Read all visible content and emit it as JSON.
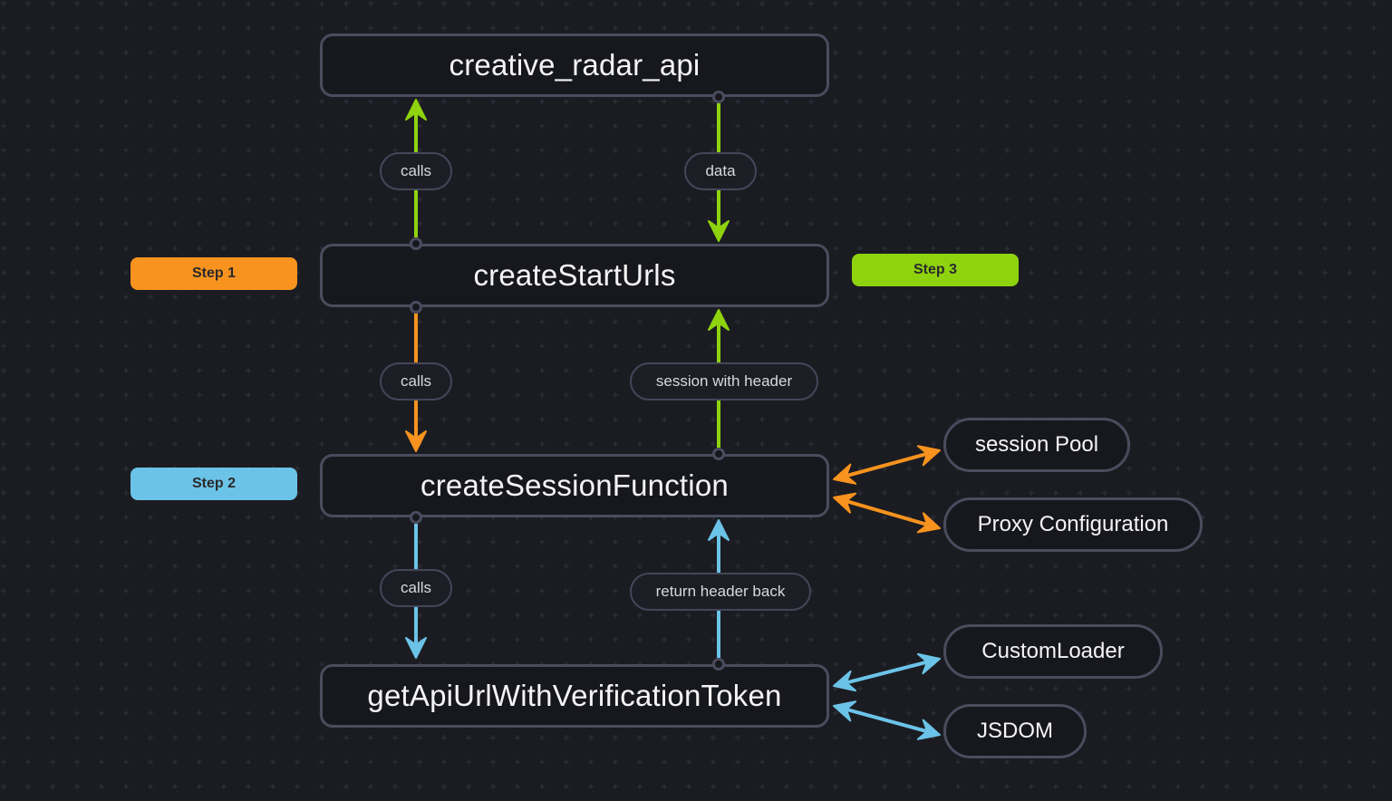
{
  "colors": {
    "green": "#8fd30f",
    "orange": "#f7931e",
    "blue": "#6cc3e8",
    "node_border": "#4a4c5e"
  },
  "nodes": {
    "creative_radar_api": "creative_radar_api",
    "createStartUrls": "createStartUrls",
    "createSessionFunction": "createSessionFunction",
    "getApiUrlWithVerificationToken": "getApiUrlWithVerificationToken"
  },
  "side_nodes": {
    "session_pool": "session Pool",
    "proxy_configuration": "Proxy Configuration",
    "custom_loader": "CustomLoader",
    "jsdom": "JSDOM"
  },
  "steps": {
    "step1": {
      "label": "Step 1",
      "color": "#f7931e"
    },
    "step2": {
      "label": "Step 2",
      "color": "#6cc3e8"
    },
    "step3": {
      "label": "Step 3",
      "color": "#8fd30f"
    }
  },
  "edges": [
    {
      "from": "createStartUrls",
      "to": "creative_radar_api",
      "label": "calls",
      "color": "green"
    },
    {
      "from": "creative_radar_api",
      "to": "createStartUrls",
      "label": "data",
      "color": "green"
    },
    {
      "from": "createStartUrls",
      "to": "createSessionFunction",
      "label": "calls",
      "color": "orange"
    },
    {
      "from": "createSessionFunction",
      "to": "createStartUrls",
      "label": "session with header",
      "color": "green"
    },
    {
      "from": "createSessionFunction",
      "to": "getApiUrlWithVerificationToken",
      "label": "calls",
      "color": "blue"
    },
    {
      "from": "getApiUrlWithVerificationToken",
      "to": "createSessionFunction",
      "label": "return header back",
      "color": "blue"
    },
    {
      "from": "createSessionFunction",
      "to": "session Pool",
      "label": "",
      "color": "orange",
      "bidirectional": true
    },
    {
      "from": "createSessionFunction",
      "to": "Proxy Configuration",
      "label": "",
      "color": "orange",
      "bidirectional": true
    },
    {
      "from": "getApiUrlWithVerificationToken",
      "to": "CustomLoader",
      "label": "",
      "color": "blue",
      "bidirectional": true
    },
    {
      "from": "getApiUrlWithVerificationToken",
      "to": "JSDOM",
      "label": "",
      "color": "blue",
      "bidirectional": true
    }
  ]
}
